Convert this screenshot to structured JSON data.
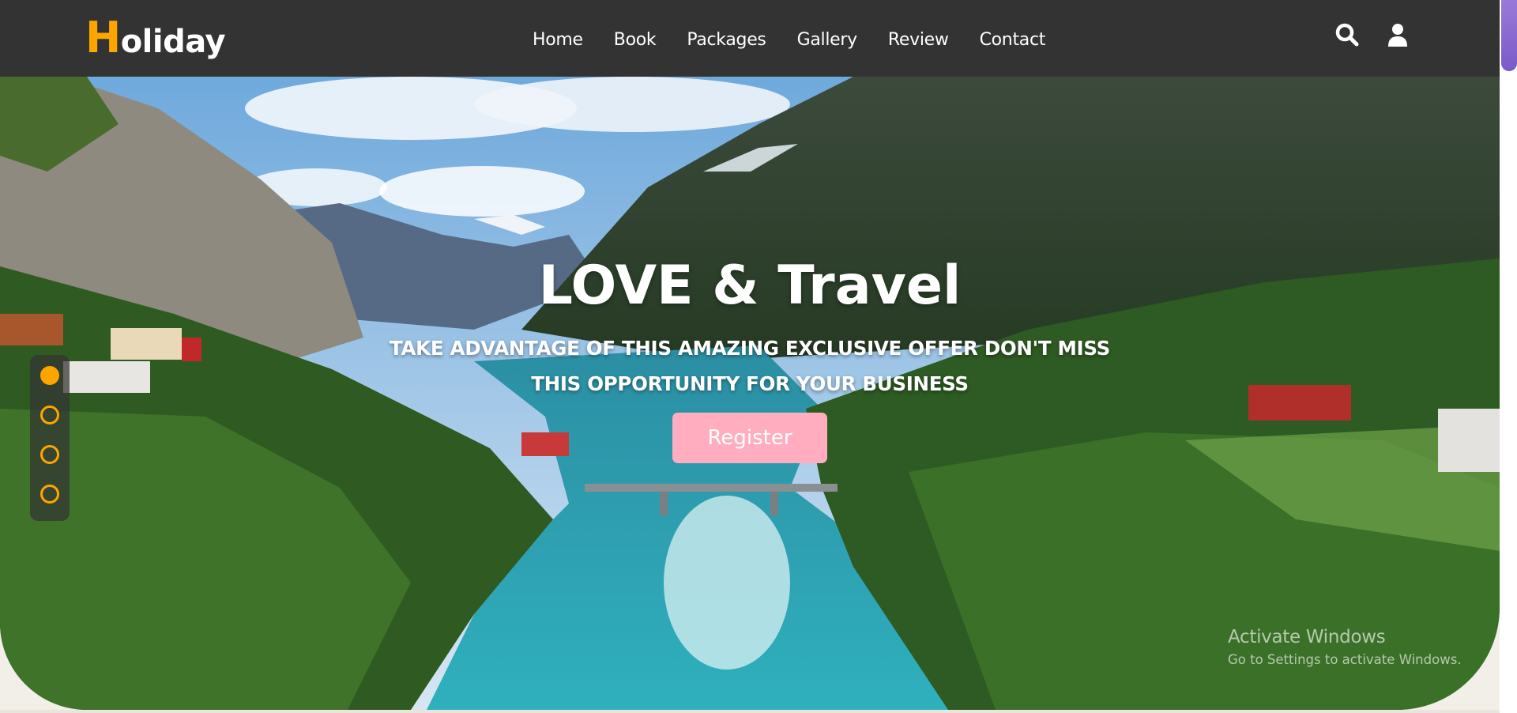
{
  "brand": {
    "logo_first": "H",
    "logo_rest": "oliday",
    "accent": "#ffa500"
  },
  "nav": {
    "items": [
      {
        "label": "Home"
      },
      {
        "label": "Book"
      },
      {
        "label": "Packages"
      },
      {
        "label": "Gallery"
      },
      {
        "label": "Review"
      },
      {
        "label": "Contact"
      }
    ]
  },
  "header_icons": {
    "search": "search-icon",
    "user": "user-icon"
  },
  "hero": {
    "title": "LOVE & Travel",
    "subtitle": "TAKE ADVANTAGE OF THIS AMAZING EXCLUSIVE OFFER DON'T MISS THIS OPPORTUNITY FOR YOUR BUSINESS",
    "cta_label": "Register",
    "cta_color": "#ffadbf"
  },
  "slider": {
    "count": 4,
    "active_index": 0
  },
  "watermark": {
    "line1": "Activate Windows",
    "line2": "Go to Settings to activate Windows."
  },
  "colors": {
    "header_bg": "#333333",
    "scroll_thumb": "#8a6ad0"
  }
}
